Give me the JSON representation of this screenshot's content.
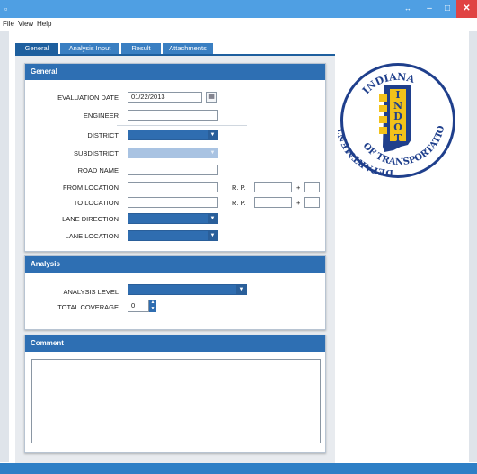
{
  "window": {
    "icon": "app-icon",
    "restore_glyph": "↔",
    "minimize": "–",
    "maximize": "□",
    "close": "✕"
  },
  "menu": {
    "file": "File",
    "view": "View",
    "help": "Help"
  },
  "tabs": [
    {
      "label": "General"
    },
    {
      "label": "Analysis Input"
    },
    {
      "label": "Result"
    },
    {
      "label": "Attachments"
    }
  ],
  "general": {
    "title": "General",
    "evaluation_date_label": "EVALUATION DATE",
    "evaluation_date_value": "01/22/2013",
    "engineer_label": "ENGINEER",
    "district_label": "DISTRICT",
    "subdistrict_label": "SUBDISTRICT",
    "road_name_label": "ROAD NAME",
    "from_location_label": "FROM LOCATION",
    "to_location_label": "TO LOCATION",
    "rp_label": "R. P.",
    "plus": "+",
    "lane_direction_label": "LANE DIRECTION",
    "lane_location_label": "LANE LOCATION"
  },
  "analysis": {
    "title": "Analysis",
    "analysis_level_label": "ANALYSIS LEVEL",
    "total_coverage_label": "TOTAL COVERAGE",
    "total_coverage_value": "0"
  },
  "comment": {
    "title": "Comment"
  },
  "logo": {
    "top": "INDIANA",
    "left": "DEPARTMENT",
    "bottom": "OF TRANSPORTATION",
    "vertical": [
      "I",
      "N",
      "D",
      "O",
      "T"
    ],
    "color_blue": "#1f3f8c",
    "color_gold": "#f2c21a"
  },
  "colors": {
    "accent": "#2e6fb3",
    "titlebar": "#4f9fe3"
  }
}
